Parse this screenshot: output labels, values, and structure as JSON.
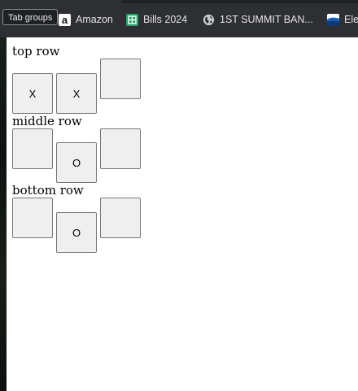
{
  "browser": {
    "tooltip": "Tab groups",
    "bookmarks": [
      {
        "label": "Amazon",
        "icon": "amazon-icon"
      },
      {
        "label": "Bills 2024",
        "icon": "sheets-icon"
      },
      {
        "label": "1ST SUMMIT BAN...",
        "icon": "globe-icon"
      },
      {
        "label": "Ele",
        "icon": "flag-icon"
      }
    ]
  },
  "board": {
    "rows": [
      {
        "label": "top row",
        "cells": [
          "X",
          "X",
          ""
        ]
      },
      {
        "label": "middle row",
        "cells": [
          "",
          "O",
          ""
        ]
      },
      {
        "label": "bottom row",
        "cells": [
          "",
          "O",
          ""
        ]
      }
    ]
  }
}
